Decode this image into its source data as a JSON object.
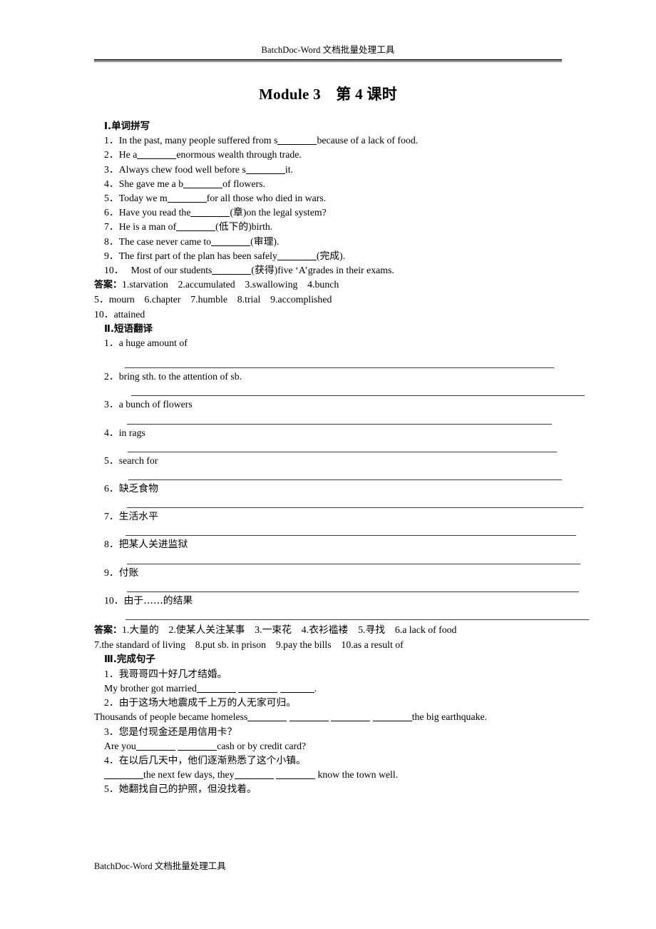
{
  "header": {
    "text": "BatchDoc-Word 文档批量处理工具"
  },
  "footer": {
    "text": "BatchDoc-Word 文档批量处理工具"
  },
  "title": "Module 3　第 4 课时",
  "sections": [
    {
      "heading": "Ⅰ.单词拼写",
      "items": [
        {
          "num": "1．",
          "pre": "In the past, many people suffered from s",
          "post": "because of a lack of food."
        },
        {
          "num": "2．",
          "pre": "He a",
          "post": "enormous wealth through trade."
        },
        {
          "num": "3．",
          "pre": "Always chew food well before s",
          "post": "it."
        },
        {
          "num": "4．",
          "pre": "She gave me a b",
          "post": "of flowers."
        },
        {
          "num": "5．",
          "pre": "Today we m",
          "post": "for all those who died in wars."
        },
        {
          "num": "6．",
          "pre": "Have you read the",
          "post": "(章)on the legal system?"
        },
        {
          "num": "7．",
          "pre": "He is a man of",
          "post": "(低下的)birth."
        },
        {
          "num": "8．",
          "pre": "The case never came to",
          "post": "(审理)."
        },
        {
          "num": "9．",
          "pre": "The first part of the plan has been safely",
          "post": "(完成)."
        },
        {
          "num": "10．",
          "pre": "Most of our students",
          "post": "(获得)five ‘A’grades in their exams."
        }
      ],
      "answer_label": "答案：",
      "answer_lines": [
        "1.starvation　2.accumulated　3.swallowing　4.bunch",
        "5．mourn　6.chapter　7.humble　8.trial　9.accomplished",
        "10．attained"
      ]
    },
    {
      "heading": "Ⅱ.短语翻译",
      "items": [
        {
          "num": "1．",
          "text": "a huge amount of"
        },
        {
          "num": "2．",
          "text": "bring sth. to the attention of sb."
        },
        {
          "num": "3．",
          "text": "a bunch of flowers"
        },
        {
          "num": "4．",
          "text": "in rags"
        },
        {
          "num": "5．",
          "text": "search for"
        },
        {
          "num": "6．",
          "text": "缺乏食物"
        },
        {
          "num": "7．",
          "text": "生活水平"
        },
        {
          "num": "8．",
          "text": "把某人关进监狱"
        },
        {
          "num": "9．",
          "text": "付账"
        },
        {
          "num": "10．",
          "text": "由于……的结果"
        }
      ],
      "answer_label": "答案：",
      "answer_lines": [
        "1.大量的　2.使某人关注某事　3.一束花　4.衣衫褴褛　5.寻找　6.a lack of food",
        "7.the standard of living　8.put sb. in prison　9.pay the bills　10.as a result of"
      ]
    },
    {
      "heading": "Ⅲ.完成句子",
      "items": [
        {
          "num": "1．",
          "cn": "我哥哥四十好几才结婚。",
          "en_pre": "My brother got married",
          "en_mid": "",
          "en_post": ".",
          "blanks": 3
        },
        {
          "num": "2．",
          "cn": "由于这场大地震成千上万的人无家可归。",
          "en_pre": "Thousands of people became homeless",
          "en_post": "the big earthquake.",
          "blanks": 4
        },
        {
          "num": "3．",
          "cn": "您是付现金还是用信用卡？",
          "en_pre": "Are you",
          "en_post": "cash or by credit card?",
          "blanks": 2
        },
        {
          "num": "4．",
          "cn": "在以后几天中，他们逐渐熟悉了这个小镇。",
          "en_pre": "",
          "en_mid1": "the next few days, they",
          "en_post": "know the town well.",
          "blanks": 3
        },
        {
          "num": "5．",
          "cn": "她翻找自己的护照，但没找着。"
        }
      ]
    }
  ]
}
